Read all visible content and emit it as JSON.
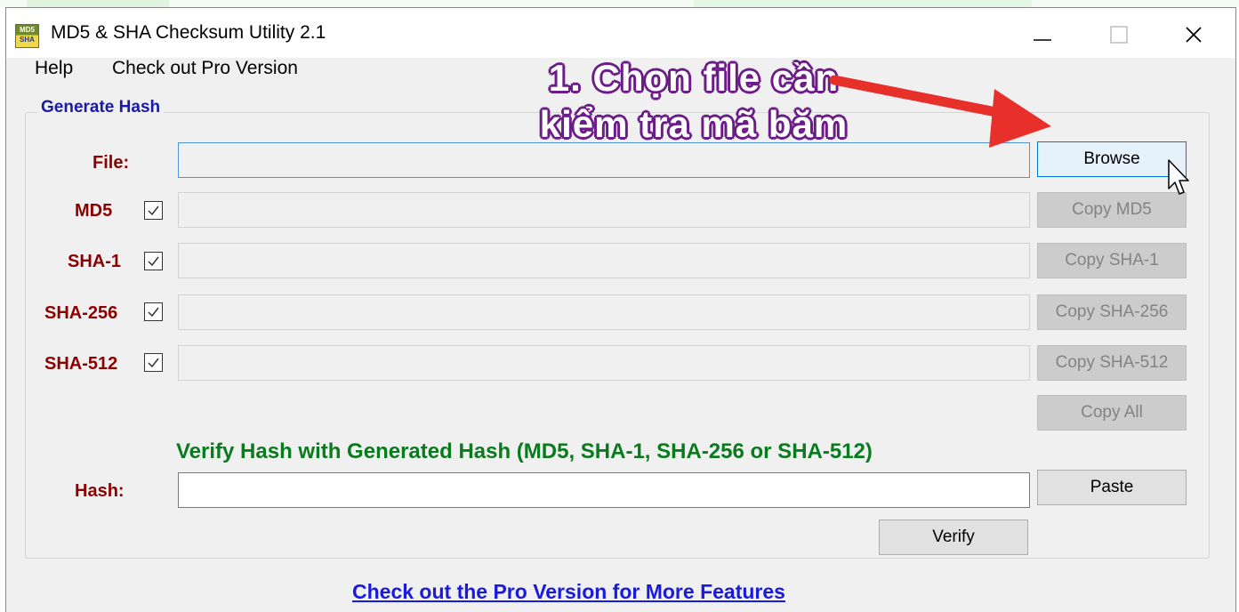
{
  "window": {
    "title": "MD5 & SHA Checksum Utility 2.1",
    "icon_text_top": "MD5",
    "icon_text_bottom": "SHA",
    "controls": {
      "minimize": "—",
      "maximize": "☐",
      "close": "✕"
    }
  },
  "menu": {
    "items": [
      {
        "label": "Help"
      },
      {
        "label": "Check out Pro Version"
      }
    ]
  },
  "generate": {
    "title": "Generate Hash",
    "file_label": "File:",
    "rows": [
      {
        "label": "MD5",
        "checked": true,
        "copy_label": "Copy MD5"
      },
      {
        "label": "SHA-1",
        "checked": true,
        "copy_label": "Copy SHA-1"
      },
      {
        "label": "SHA-256",
        "checked": true,
        "copy_label": "Copy SHA-256"
      },
      {
        "label": "SHA-512",
        "checked": true,
        "copy_label": "Copy SHA-512"
      }
    ],
    "browse_label": "Browse",
    "copy_all_label": "Copy All"
  },
  "verify": {
    "title": "Verify Hash with Generated Hash (MD5, SHA-1, SHA-256 or SHA-512)",
    "hash_label": "Hash:",
    "paste_label": "Paste",
    "verify_label": "Verify"
  },
  "footer": {
    "link_label": "Check out the Pro Version for More Features"
  },
  "annotation": {
    "line1": "1. Chọn file cần",
    "line2": "kiểm tra mã băm"
  },
  "colors": {
    "accent_label": "#8b0000",
    "group_title": "#1a1aa6",
    "verify_title": "#0a7a1e",
    "link": "#1a1add",
    "arrow": "#e8302a",
    "annotation_outline": "#6b1c86"
  }
}
